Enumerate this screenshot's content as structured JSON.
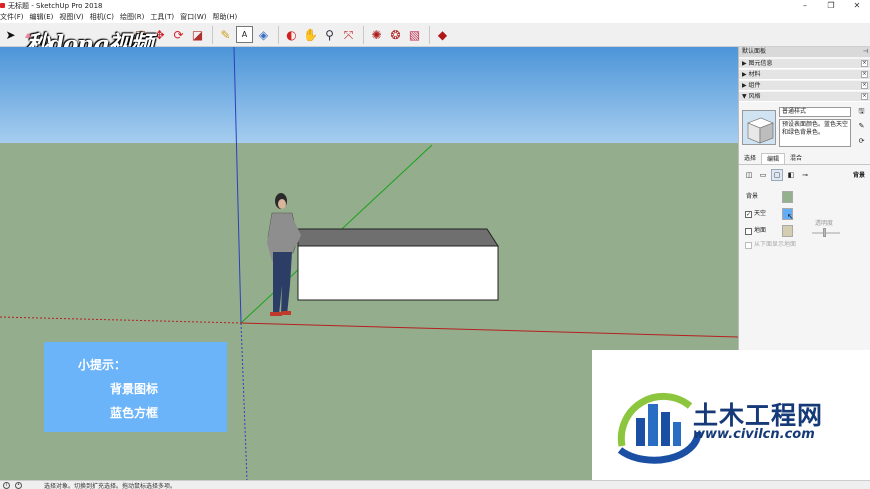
{
  "window": {
    "title": "无标题 - SketchUp Pro 2018",
    "controls": [
      "–",
      "❐",
      "✕"
    ]
  },
  "menu": [
    "文件(F)",
    "编辑(E)",
    "视图(V)",
    "相机(C)",
    "绘图(R)",
    "工具(T)",
    "窗口(W)",
    "帮助(H)"
  ],
  "watermark": "秒dong视频",
  "toolbar_icons": [
    "select-arrow-icon",
    "eraser-icon",
    "line-icon",
    "shape-icon",
    "push-pull-icon",
    "move-icon",
    "rotate-icon",
    "scale-icon",
    "offset-icon",
    "tape-measure-icon",
    "text-icon",
    "paint-bucket-icon",
    "orbit-icon",
    "pan-icon",
    "zoom-icon",
    "zoom-extents-icon",
    "warehouse-icon",
    "extension-icon",
    "share-icon",
    "ruby-icon"
  ],
  "tip": {
    "title": "小提示：",
    "line1": "背景图标",
    "line2": "蓝色方框"
  },
  "status": {
    "text": "选择对象。切换到扩充选择。拖动鼠标选择多项。"
  },
  "tray": {
    "header": "默认面板",
    "rows": [
      "▶ 图元信息",
      "▶ 材料",
      "▶ 组件",
      "▼ 风格"
    ],
    "style_name": "普通样式",
    "style_desc": "预设表面颜色。蓝色天空和绿色背景色。",
    "tabs": [
      "选择",
      "编辑",
      "混合"
    ],
    "section_label": "背景",
    "background_label": "背景",
    "sky_label": "天空",
    "ground_label": "地面",
    "opacity_label": "透明度",
    "show_ground_label": "从下面显示地面",
    "sky_checked": "✓",
    "colors": {
      "background": "#92b18c",
      "sky": "#62aef6",
      "ground": "#d3ceb2"
    }
  },
  "logo": {
    "name": "土木工程网",
    "url": "www.civilcn.com"
  }
}
